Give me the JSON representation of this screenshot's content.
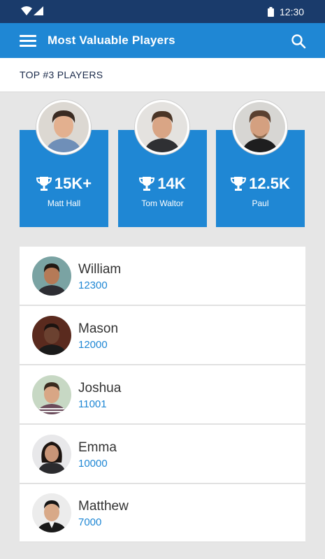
{
  "status_bar": {
    "time": "12:30"
  },
  "app_bar": {
    "title": "Most Valuable Players"
  },
  "section": {
    "title": "TOP #3 PLAYERS"
  },
  "top_players": [
    {
      "score": "15K+",
      "name": "Matt Hall"
    },
    {
      "score": "14K",
      "name": "Tom Waltor"
    },
    {
      "score": "12.5K",
      "name": "Paul"
    }
  ],
  "players": [
    {
      "name": "William",
      "score": "12300"
    },
    {
      "name": "Mason",
      "score": "12000"
    },
    {
      "name": "Joshua",
      "score": "11001"
    },
    {
      "name": "Emma",
      "score": "10000"
    },
    {
      "name": "Matthew",
      "score": "7000"
    }
  ],
  "colors": {
    "accent": "#1f87d4",
    "status_bar": "#1a3b6b",
    "background": "#e6e6e6"
  }
}
